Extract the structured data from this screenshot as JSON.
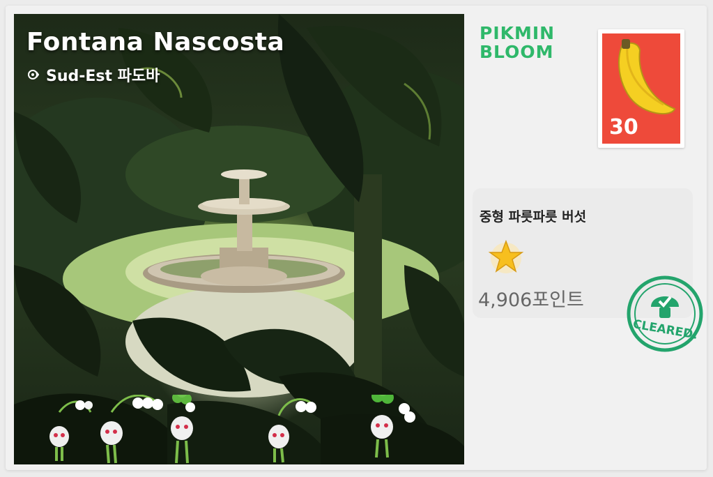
{
  "postcard": {
    "title": "Fontana Nascosta",
    "location": "Sud-Est 파도바"
  },
  "logo": {
    "line1": "PIKMIN",
    "line2": "BLOOM"
  },
  "stamp": {
    "value": "30",
    "icon": "banana-icon"
  },
  "mushroom": {
    "name": "중형 파릇파릇 버섯",
    "rank_icon": "star-icon",
    "points": "4,906포인트"
  },
  "badge": {
    "label": "CLEARED!",
    "color": "#23a46c"
  },
  "colors": {
    "stamp_red": "#ee4a3a",
    "logo_green": "#2fb86a"
  }
}
